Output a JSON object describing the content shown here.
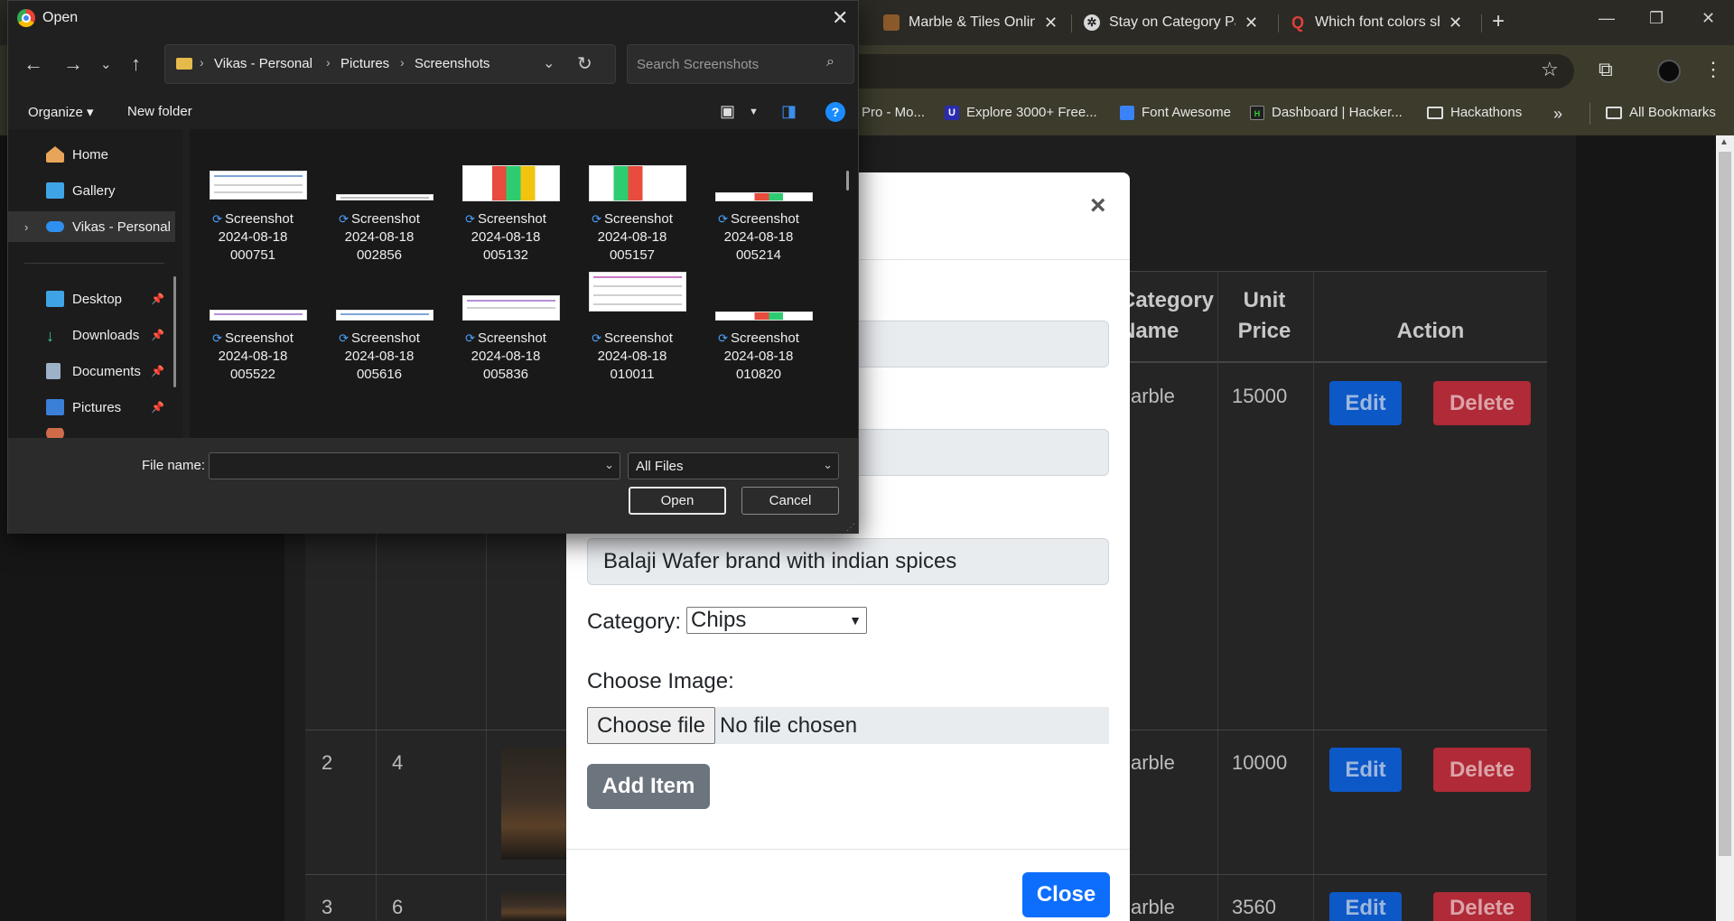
{
  "browser": {
    "tabs": [
      {
        "title": "Marble & Tiles Online",
        "favicon_color": "#8b5a2b"
      },
      {
        "title": "Stay on Category Page",
        "favicon_color": "#cccccc"
      },
      {
        "title": "Which font colors should",
        "favicon_color": "#b92b27"
      }
    ],
    "bookmarks": [
      {
        "label": "Pro - Mo...",
        "icon_color": "#555555"
      },
      {
        "label": "Explore 3000+ Free...",
        "icon_color": "#2b2bb0"
      },
      {
        "label": "Font Awesome",
        "icon_color": "#3b82f6"
      },
      {
        "label": "Dashboard | Hacker...",
        "icon_color": "#1f1f1f"
      },
      {
        "label": "Hackathons",
        "icon_color": "folder"
      }
    ],
    "all_bookmarks": "All Bookmarks"
  },
  "table": {
    "headers": {
      "category": "Category Name",
      "unit_price": "Unit Price",
      "action": "Action"
    },
    "rows": [
      {
        "id": "",
        "col2": "",
        "category": "arble",
        "price": "15000"
      },
      {
        "id": "2",
        "col2": "4",
        "category": "arble",
        "price": "10000"
      },
      {
        "id": "3",
        "col2": "6",
        "category": "arble",
        "price": "3560"
      }
    ],
    "edit_label": "Edit",
    "delete_label": "Delete"
  },
  "modal": {
    "close_symbol": "×",
    "description_value": "Balaji Wafer brand with indian spices",
    "category_label": "Category:",
    "category_selected": "Chips",
    "image_label": "Choose Image:",
    "choose_file_label": "Choose file",
    "no_file_text": "No file chosen",
    "add_item_label": "Add Item",
    "close_label": "Close"
  },
  "dialog": {
    "title": "Open",
    "breadcrumbs": [
      "Vikas - Personal",
      "Pictures",
      "Screenshots"
    ],
    "search_placeholder": "Search Screenshots",
    "organize_label": "Organize",
    "new_folder_label": "New folder",
    "nav": {
      "home": "Home",
      "gallery": "Gallery",
      "onedrive": "Vikas - Personal",
      "desktop": "Desktop",
      "downloads": "Downloads",
      "documents": "Documents",
      "pictures": "Pictures"
    },
    "files": [
      {
        "line1": "Screenshot",
        "line2": "2024-08-18",
        "line3": "000751"
      },
      {
        "line1": "Screenshot",
        "line2": "2024-08-18",
        "line3": "002856"
      },
      {
        "line1": "Screenshot",
        "line2": "2024-08-18",
        "line3": "005132"
      },
      {
        "line1": "Screenshot",
        "line2": "2024-08-18",
        "line3": "005157"
      },
      {
        "line1": "Screenshot",
        "line2": "2024-08-18",
        "line3": "005214"
      },
      {
        "line1": "Screenshot",
        "line2": "2024-08-18",
        "line3": "005522"
      },
      {
        "line1": "Screenshot",
        "line2": "2024-08-18",
        "line3": "005616"
      },
      {
        "line1": "Screenshot",
        "line2": "2024-08-18",
        "line3": "005836"
      },
      {
        "line1": "Screenshot",
        "line2": "2024-08-18",
        "line3": "010011"
      },
      {
        "line1": "Screenshot",
        "line2": "2024-08-18",
        "line3": "010820"
      }
    ],
    "file_name_label": "File name:",
    "file_name_value": "",
    "file_type_selected": "All Files",
    "open_label": "Open",
    "cancel_label": "Cancel"
  },
  "colors": {
    "accent_blue": "#0d6efd",
    "edit_blue": "#0d58c7",
    "delete_red": "#b02a37",
    "add_item_gray": "#6c757d"
  }
}
